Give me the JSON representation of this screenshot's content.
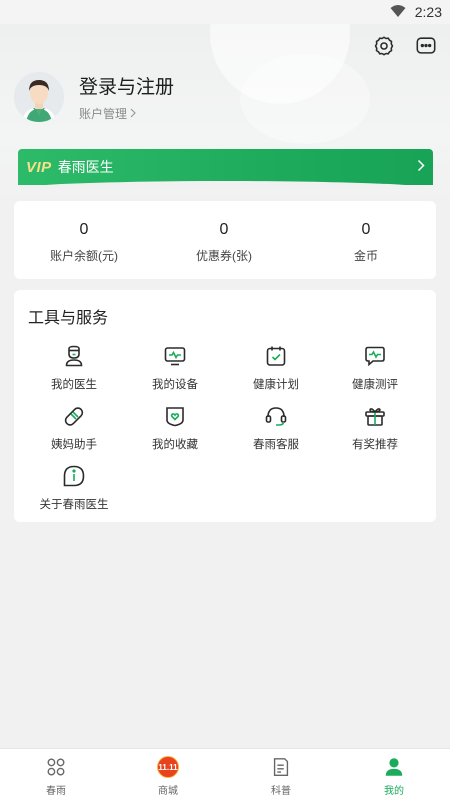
{
  "status_bar": {
    "time": "2:23"
  },
  "profile": {
    "title": "登录与注册",
    "subtitle": "账户管理"
  },
  "vip": {
    "logo": "VIP",
    "label": "春雨医生"
  },
  "stats": [
    {
      "value": "0",
      "label": "账户余额(元)"
    },
    {
      "value": "0",
      "label": "优惠券(张)"
    },
    {
      "value": "0",
      "label": "金币"
    }
  ],
  "tools": {
    "title": "工具与服务",
    "items": [
      {
        "label": "我的医生",
        "icon": "doctor-icon"
      },
      {
        "label": "我的设备",
        "icon": "device-icon"
      },
      {
        "label": "健康计划",
        "icon": "health-plan-icon"
      },
      {
        "label": "健康测评",
        "icon": "health-assessment-icon"
      },
      {
        "label": "姨妈助手",
        "icon": "period-helper-icon"
      },
      {
        "label": "我的收藏",
        "icon": "favorites-icon"
      },
      {
        "label": "春雨客服",
        "icon": "customer-service-icon"
      },
      {
        "label": "有奖推荐",
        "icon": "gift-icon"
      },
      {
        "label": "关于春雨医生",
        "icon": "info-icon"
      }
    ]
  },
  "tab_bar": {
    "items": [
      {
        "label": "春雨",
        "icon": "home-grid-icon"
      },
      {
        "label": "商城",
        "icon": "mall-1111-icon",
        "badge": "11.11"
      },
      {
        "label": "科普",
        "icon": "article-icon"
      },
      {
        "label": "我的",
        "icon": "profile-icon",
        "active": true
      }
    ]
  },
  "colors": {
    "accent": "#1aab5b",
    "vip_gold": "#f6e08a",
    "icon_stroke": "#2b2b2b"
  }
}
